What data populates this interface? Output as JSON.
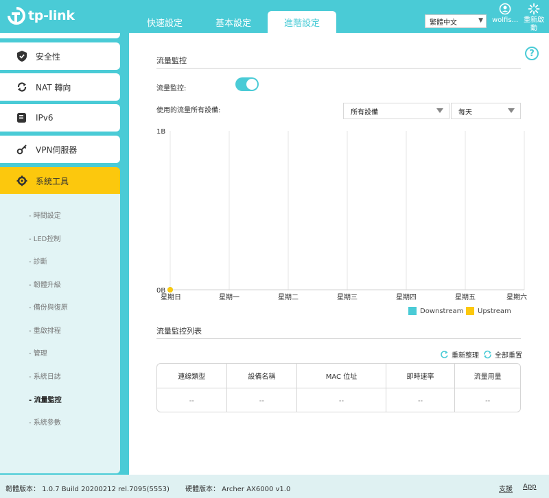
{
  "header": {
    "logo_text": "tp-link",
    "tabs": [
      {
        "label": "快速設定"
      },
      {
        "label": "基本設定"
      },
      {
        "label": "進階設定"
      }
    ],
    "language": "繁體中文",
    "user_label": "wolfis...",
    "reboot_label": "重新啟動",
    "accent_color": "#4acbd6"
  },
  "sidebar": {
    "items": [
      {
        "label": "安全性",
        "icon": "shield-icon"
      },
      {
        "label": "NAT 轉向",
        "icon": "nat-forwarding-icon"
      },
      {
        "label": "IPv6",
        "icon": "ipv6-icon"
      },
      {
        "label": "VPN伺服器",
        "icon": "vpn-key-icon"
      },
      {
        "label": "系統工具",
        "icon": "gear-icon"
      }
    ],
    "active_color": "#fcc80d",
    "submenu": [
      {
        "label": "- 時間設定"
      },
      {
        "label": "- LED控制"
      },
      {
        "label": "- 診斷"
      },
      {
        "label": "- 韌體升級"
      },
      {
        "label": "- 備份與復原"
      },
      {
        "label": "- 重啟排程"
      },
      {
        "label": "- 管理"
      },
      {
        "label": "- 系統日誌"
      },
      {
        "label": "- 流量監控"
      },
      {
        "label": "- 系統參數"
      }
    ]
  },
  "main": {
    "section1_title": "流量監控",
    "toggle_label": "流量監控:",
    "toggle_on": true,
    "usage_label": "使用的流量所有設備:",
    "device_select": "所有設備",
    "period_select": "每天",
    "section2_title": "流量監控列表",
    "refresh_label": "重新整理",
    "reset_all_label": "全部重置",
    "table": {
      "headers": [
        "連線類型",
        "設備名稱",
        "MAC 位址",
        "即時速率",
        "流量用量"
      ],
      "row": [
        "--",
        "--",
        "--",
        "--",
        "--"
      ]
    }
  },
  "chart_data": {
    "type": "line",
    "categories": [
      "星期日",
      "星期一",
      "星期二",
      "星期三",
      "星期四",
      "星期五",
      "星期六"
    ],
    "series": [
      {
        "name": "Downstream",
        "color": "#4acbd6",
        "values": [
          0
        ]
      },
      {
        "name": "Upstream",
        "color": "#fcc80d",
        "values": [
          0
        ]
      }
    ],
    "y_tick_labels": [
      "1B",
      "0B"
    ],
    "ylim": [
      0,
      1
    ],
    "grid": "vertical",
    "legend_position": "bottom-right"
  },
  "footer": {
    "firmware": "韌體版本： 1.0.7 Build 20200212 rel.7095(5553)",
    "hardware": "硬體版本： Archer AX6000 v1.0",
    "support": "支援",
    "app": "App"
  }
}
